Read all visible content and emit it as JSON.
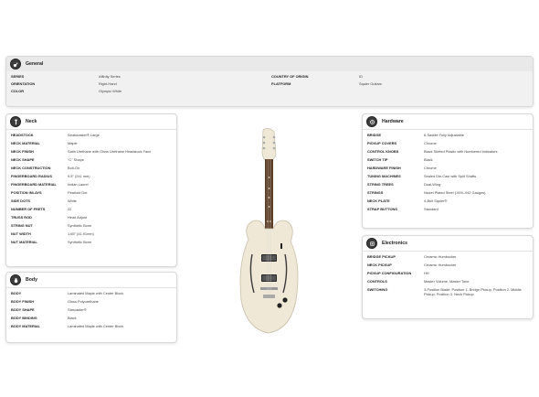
{
  "general": {
    "title": "General",
    "icon": "guitar-icon",
    "left": [
      {
        "label": "SERIES",
        "value": "Affinity Series"
      },
      {
        "label": "ORIENTATION",
        "value": "Right-Hand"
      },
      {
        "label": "COLOR",
        "value": "Olympic White"
      }
    ],
    "right": [
      {
        "label": "COUNTRY OF ORIGIN",
        "value": "ID"
      },
      {
        "label": "PLATFORM",
        "value": "Squier Guitars"
      }
    ]
  },
  "neck": {
    "title": "Neck",
    "icon": "guitar-neck-icon",
    "rows": [
      {
        "label": "HEADSTOCK",
        "value": "Stratocaster® Large"
      },
      {
        "label": "NECK MATERIAL",
        "value": "Maple"
      },
      {
        "label": "NECK FINISH",
        "value": "Satin Urethane with Gloss Urethane Headstock Face"
      },
      {
        "label": "NECK SHAPE",
        "value": "\"C\" Shape"
      },
      {
        "label": "NECK CONSTRUCTION",
        "value": "Bolt-On"
      },
      {
        "label": "FINGERBOARD RADIUS",
        "value": "9.5\" (241 mm)"
      },
      {
        "label": "FINGERBOARD MATERIAL",
        "value": "Indian Laurel"
      },
      {
        "label": "POSITION INLAYS",
        "value": "Pearloid Dot"
      },
      {
        "label": "SIDE DOTS",
        "value": "White"
      },
      {
        "label": "NUMBER OF FRETS",
        "value": "22"
      },
      {
        "label": "TRUSS ROD",
        "value": "Head Adjust"
      },
      {
        "label": "STRING NUT",
        "value": "Synthetic Bone"
      },
      {
        "label": "NUT WIDTH",
        "value": "1.65\" (41.91mm)"
      },
      {
        "label": "NUT MATERIAL",
        "value": "Synthetic Bone"
      }
    ]
  },
  "body": {
    "title": "Body",
    "icon": "guitar-body-icon",
    "rows": [
      {
        "label": "BODY",
        "value": "Laminated Maple with Center Block"
      },
      {
        "label": "BODY FINISH",
        "value": "Gloss Polyurethane"
      },
      {
        "label": "BODY SHAPE",
        "value": "Starcaster®"
      },
      {
        "label": "BODY BINDING",
        "value": "Black"
      },
      {
        "label": "BODY MATERIAL",
        "value": "Laminated Maple with Center Block"
      }
    ]
  },
  "hardware": {
    "title": "Hardware",
    "icon": "hardware-icon",
    "rows": [
      {
        "label": "BRIDGE",
        "value": "6-Saddle Fully Adjustable"
      },
      {
        "label": "PICKUP COVERS",
        "value": "Chrome"
      },
      {
        "label": "CONTROL KNOBS",
        "value": "Black Skirted Plastic with Numbered Indicators"
      },
      {
        "label": "SWITCH TIP",
        "value": "Black"
      },
      {
        "label": "HARDWARE FINISH",
        "value": "Chrome"
      },
      {
        "label": "TUNING MACHINES",
        "value": "Sealed Die-Cast with Split Shafts"
      },
      {
        "label": "STRING TREES",
        "value": "Dual-Wing"
      },
      {
        "label": "STRINGS",
        "value": "Nickel Plated Steel (.009-.042 Gauges)"
      },
      {
        "label": "NECK PLATE",
        "value": "4-Bolt Squier®"
      },
      {
        "label": "STRAP BUTTONS",
        "value": "Standard"
      }
    ]
  },
  "electronics": {
    "title": "Electronics",
    "icon": "electronics-icon",
    "rows": [
      {
        "label": "BRIDGE PICKUP",
        "value": "Ceramic Humbucker"
      },
      {
        "label": "NECK PICKUP",
        "value": "Ceramic Humbucker"
      },
      {
        "label": "PICKUP CONFIGURATION",
        "value": "HH"
      },
      {
        "label": "CONTROLS",
        "value": "Master Volume, Master Tone"
      },
      {
        "label": "SWITCHING",
        "value": "3-Position Blade: Position 1. Bridge Pickup, Position 2. Middle Pickup, Position 3. Neck Pickup"
      }
    ]
  },
  "colors": {
    "icon_bg": "#3d3d3d",
    "general_bg": "#f1f1f1",
    "guitar_body": "#efe8d6",
    "fretboard": "#5a3a22"
  }
}
